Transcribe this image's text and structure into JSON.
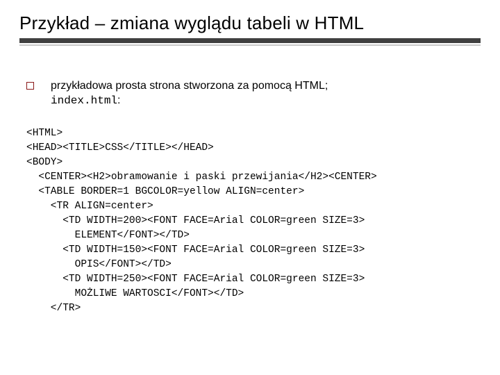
{
  "title": "Przykład – zmiana wyglądu tabeli w HTML",
  "bullet": {
    "text_before": "przykładowa prosta strona stworzona za pomocą HTML; ",
    "filename": "index.html",
    "colon": ":"
  },
  "code": {
    "l01": "<HTML>",
    "l02": "<HEAD><TITLE>CSS</TITLE></HEAD>",
    "l03": "<BODY>",
    "l04": "  <CENTER><H2>obramowanie i paski przewijania</H2><CENTER>",
    "l05": "  <TABLE BORDER=1 BGCOLOR=yellow ALIGN=center>",
    "l06": "    <TR ALIGN=center>",
    "l07": "      <TD WIDTH=200><FONT FACE=Arial COLOR=green SIZE=3>",
    "l08": "        ELEMENT</FONT></TD>",
    "l09": "      <TD WIDTH=150><FONT FACE=Arial COLOR=green SIZE=3>",
    "l10": "        OPIS</FONT></TD>",
    "l11": "      <TD WIDTH=250><FONT FACE=Arial COLOR=green SIZE=3>",
    "l12": "        MOŻLIWE WARTOSCI</FONT></TD>",
    "l13": "    </TR>"
  }
}
